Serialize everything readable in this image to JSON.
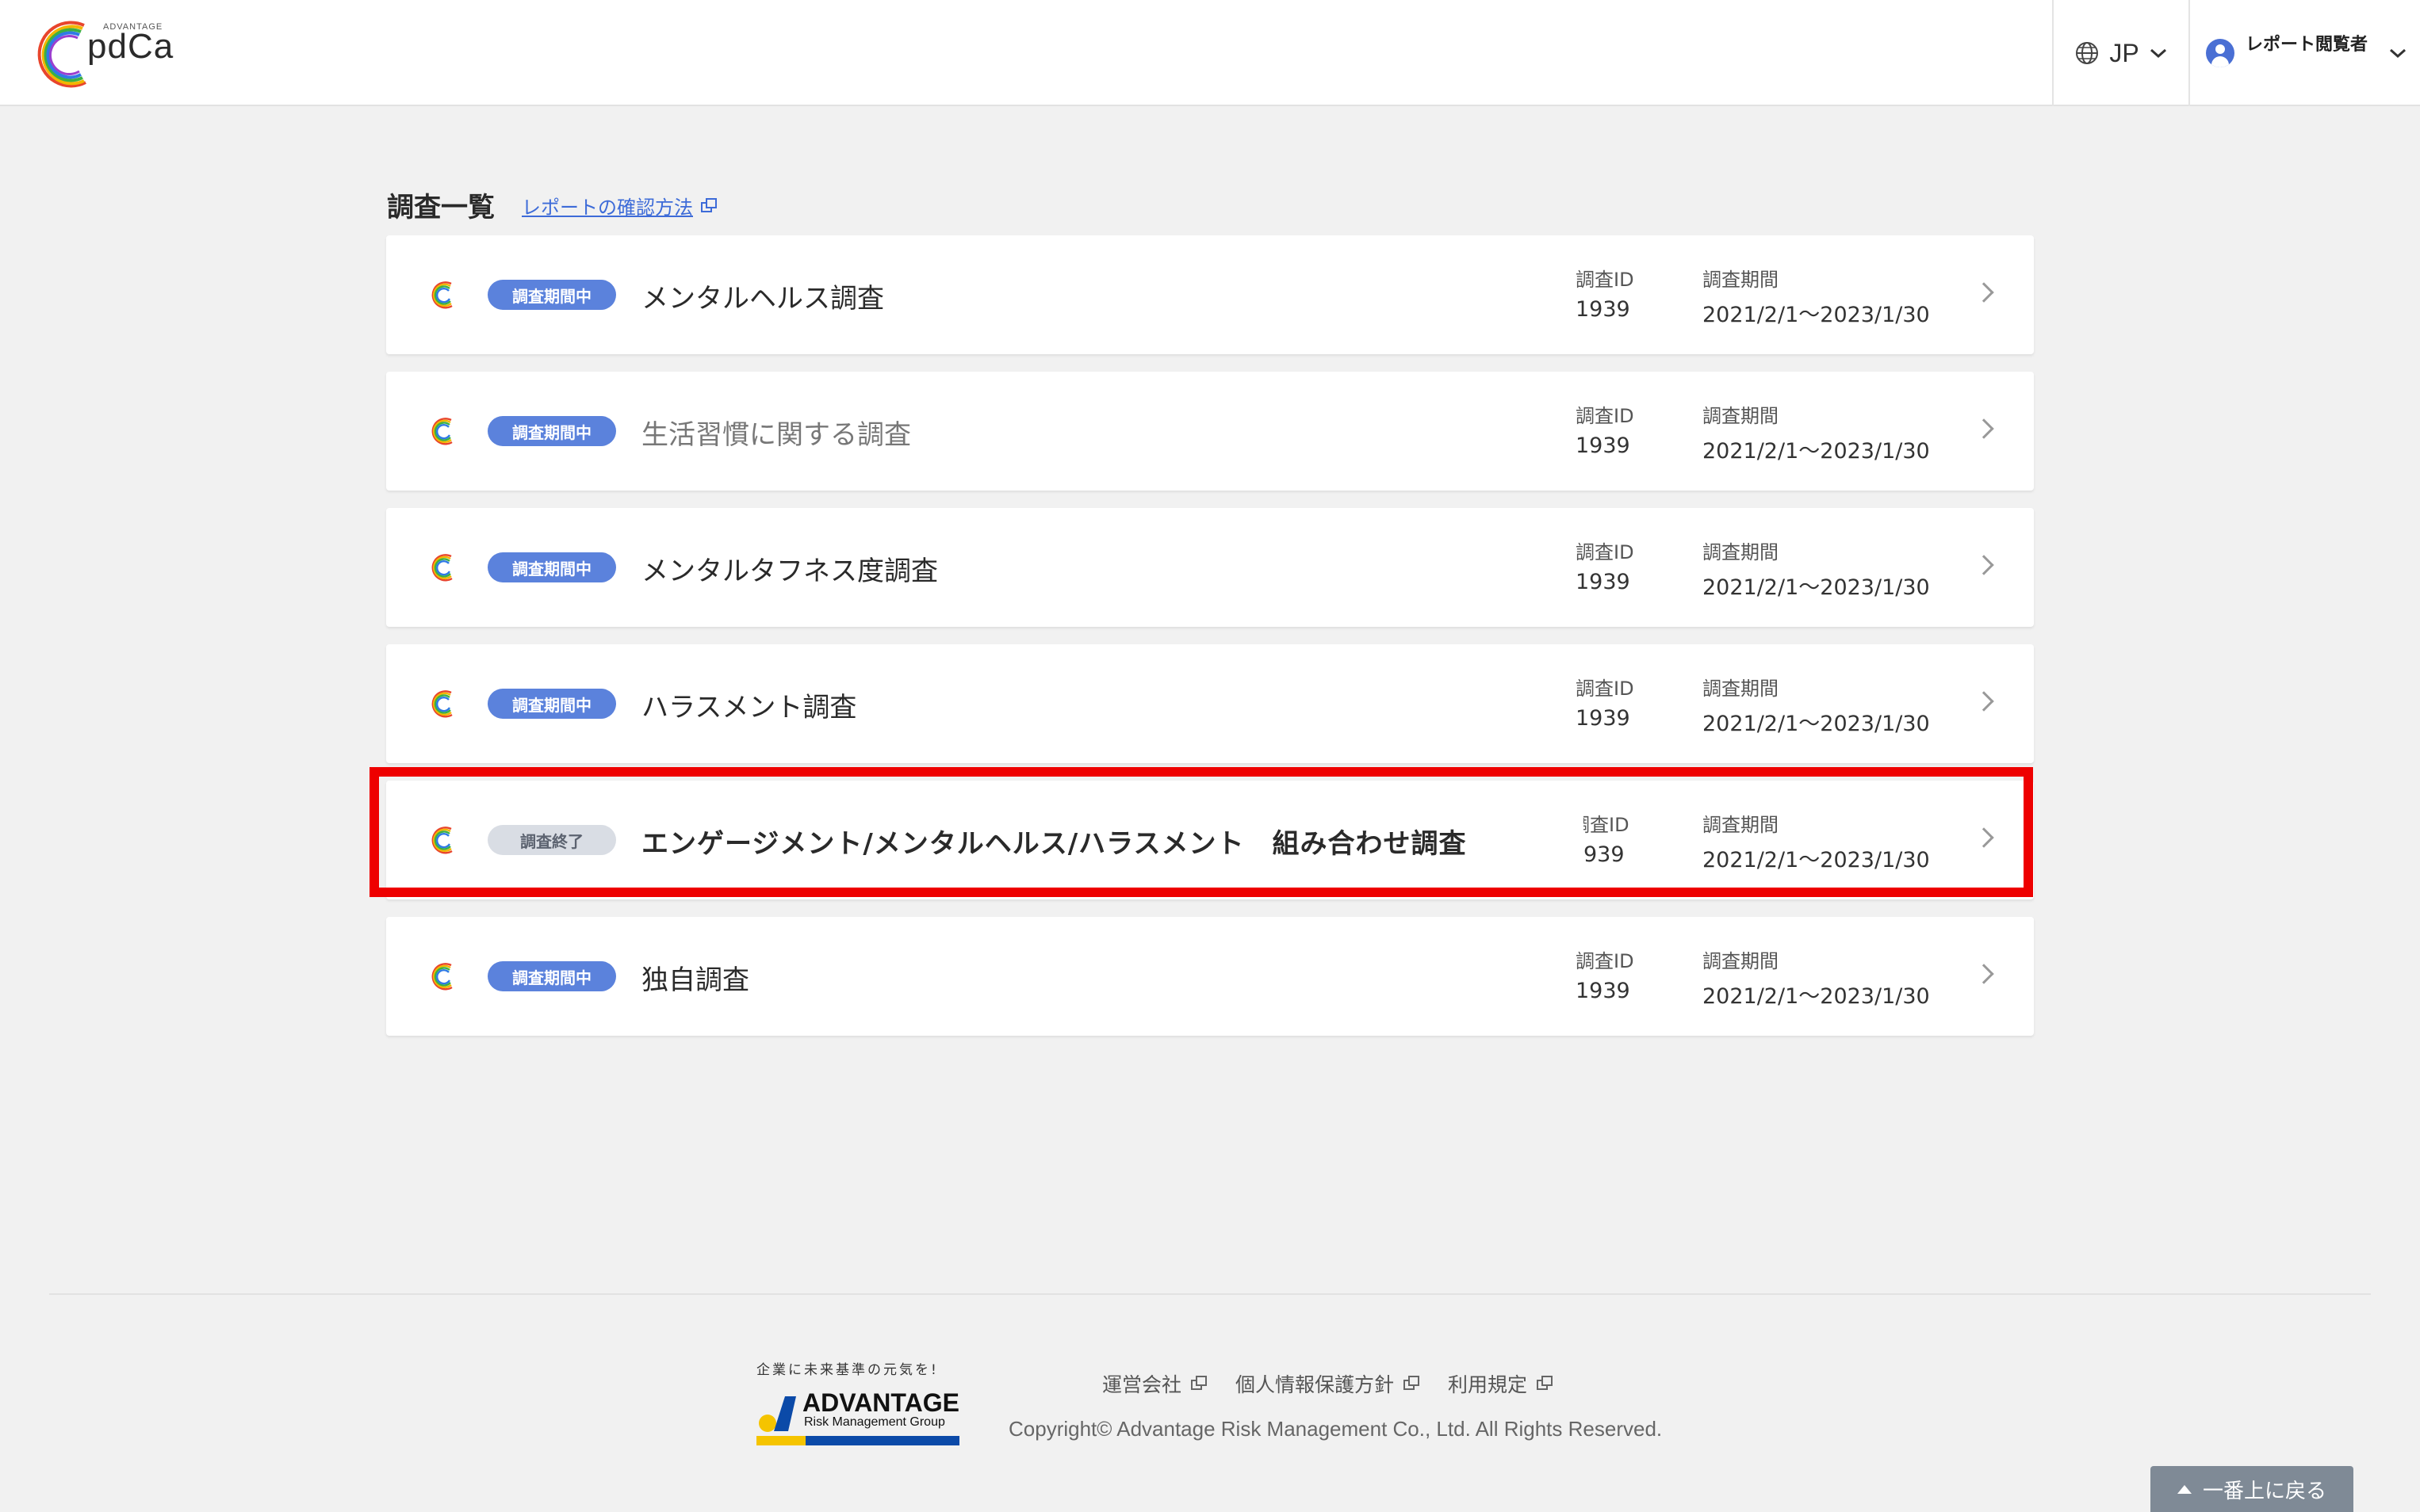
{
  "header": {
    "logo_small": "ADVANTAGE",
    "logo_text": "pdCa",
    "language": "JP",
    "user_role": "レポート閲覧者"
  },
  "main": {
    "title": "調査一覧",
    "howto_link": "レポートの確認方法",
    "meta_labels": {
      "id": "調査ID",
      "period": "調査期間"
    },
    "surveys": [
      {
        "status": "調査期間中",
        "title": "メンタルヘルス調査",
        "id": "1939",
        "period": "2021/2/1～2023/1/30"
      },
      {
        "status": "調査期間中",
        "title": "生活習慣に関する調査",
        "id": "1939",
        "period": "2021/2/1～2023/1/30"
      },
      {
        "status": "調査期間中",
        "title": "メンタルタフネス度調査",
        "id": "1939",
        "period": "2021/2/1～2023/1/30"
      },
      {
        "status": "調査期間中",
        "title": "ハラスメント調査",
        "id": "1939",
        "period": "2021/2/1～2023/1/30"
      },
      {
        "status": "調査終了",
        "title": "エンゲージメント/メンタルヘルス/ハラスメント　組み合わせ調査",
        "id": "939",
        "id_label": "調査ID",
        "period": "2021/2/1～2023/1/30"
      },
      {
        "status": "調査期間中",
        "title": "独自調査",
        "id": "1939",
        "period": "2021/2/1～2023/1/30"
      }
    ]
  },
  "footer": {
    "tagline": "企業に未来基準の元気を!",
    "brand": "ADVANTAGE",
    "brand_sub": "Risk Management Group",
    "links": [
      "運営会社",
      "個人情報保護方針",
      "利用規定"
    ],
    "copyright": "Copyright© Advantage Risk Management Co., Ltd. All Rights Reserved.",
    "back_to_top": "一番上に戻る"
  },
  "colors": {
    "accent": "#5b82dc",
    "badge_ended": "#d9dde4",
    "highlight": "#ee0000",
    "link": "#3d6bd8"
  }
}
